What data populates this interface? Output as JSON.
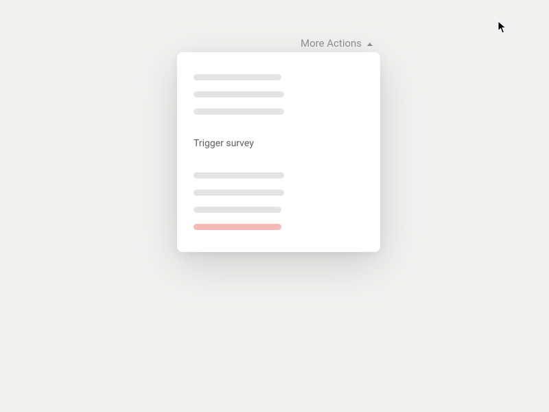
{
  "dropdown": {
    "trigger_label": "More Actions",
    "groups": [
      {
        "items": [
          {
            "kind": "placeholder",
            "variant": "default"
          },
          {
            "kind": "placeholder",
            "variant": "long"
          },
          {
            "kind": "placeholder",
            "variant": "long"
          }
        ]
      },
      {
        "items": [
          {
            "kind": "text",
            "label": "Trigger survey"
          }
        ]
      },
      {
        "items": [
          {
            "kind": "placeholder",
            "variant": "long"
          },
          {
            "kind": "placeholder",
            "variant": "long"
          },
          {
            "kind": "placeholder",
            "variant": "default"
          },
          {
            "kind": "placeholder",
            "variant": "danger"
          }
        ]
      }
    ]
  }
}
